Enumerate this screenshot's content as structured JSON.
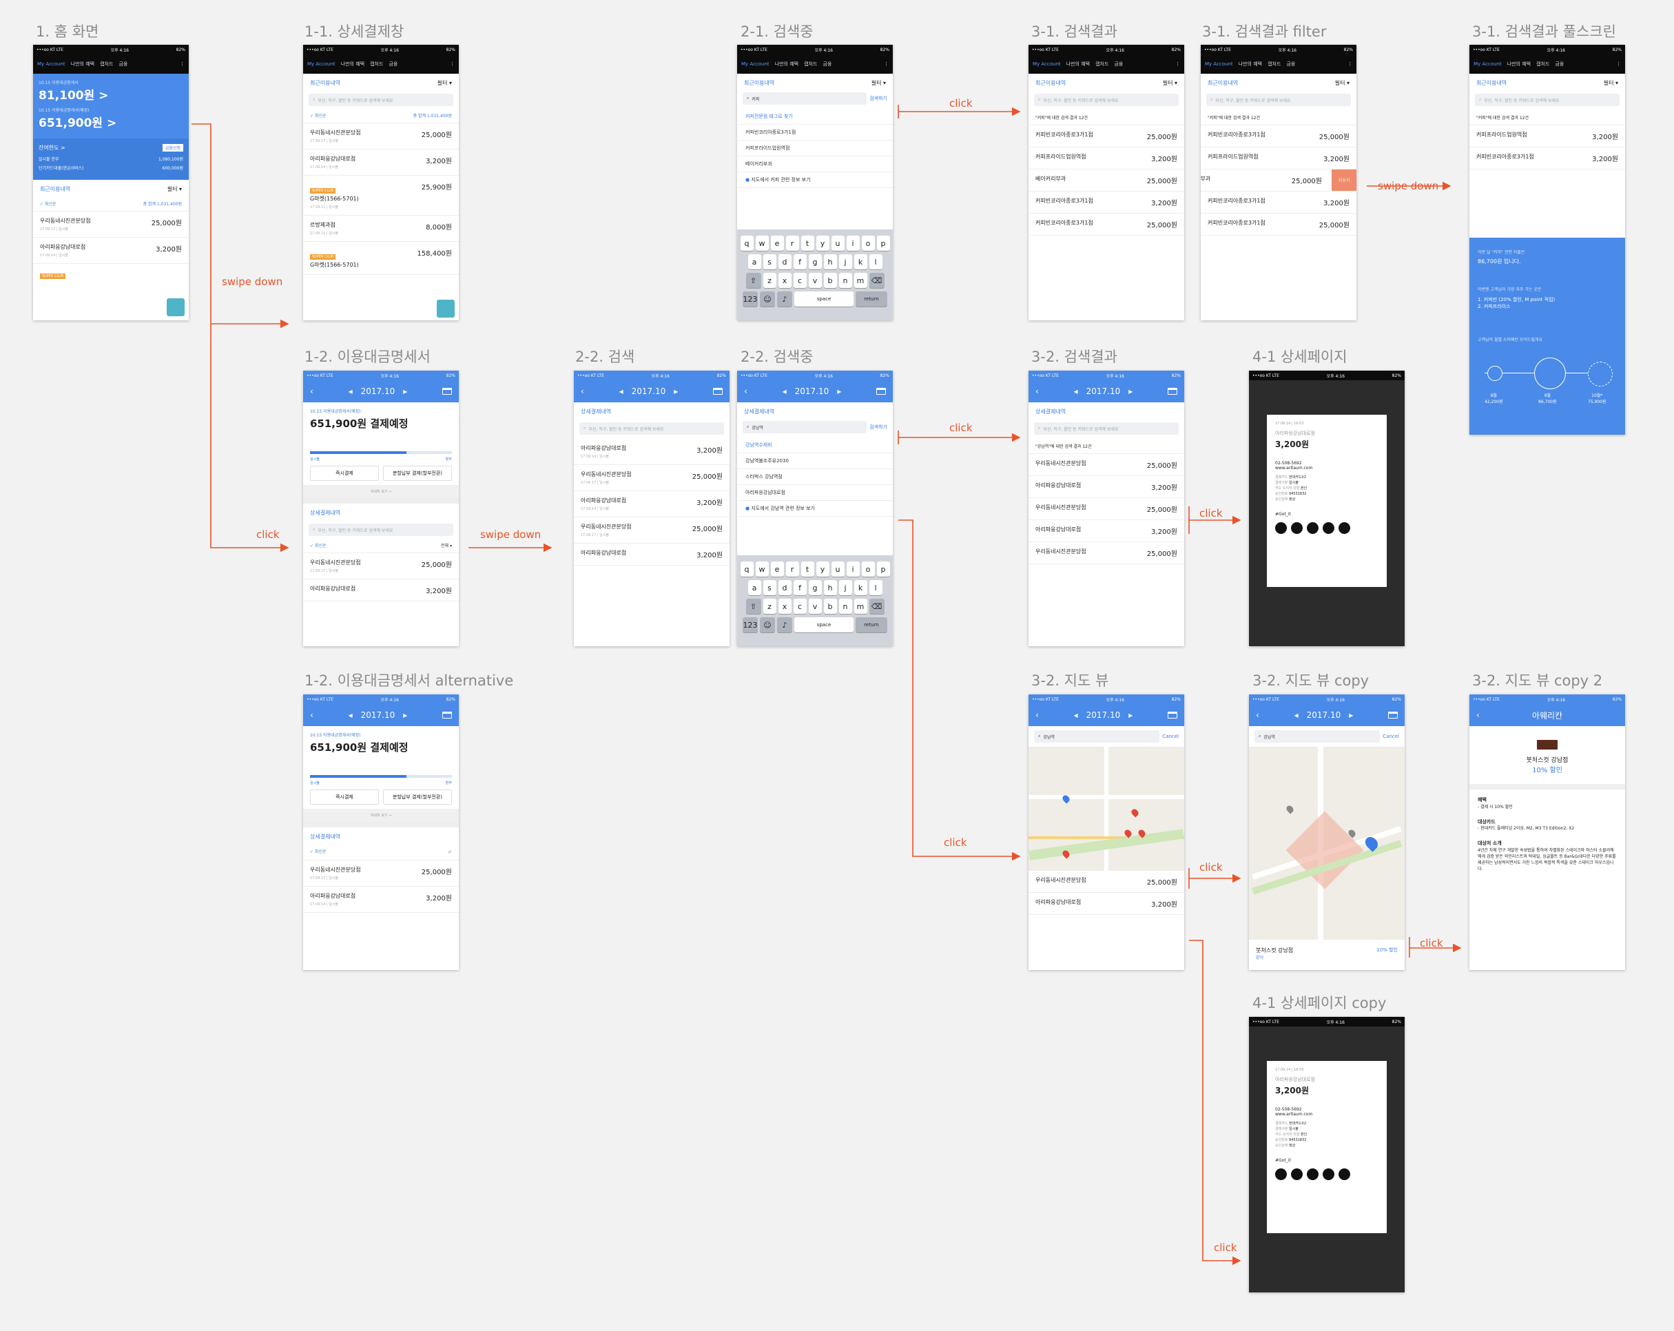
{
  "frames": {
    "f1": "1. 홈 화면",
    "f11": "1-1. 상세결제창",
    "f12": "1-2. 이용대금명세서",
    "f12alt": "1-2. 이용대금명세서 alternative",
    "f21": "2-1. 검색중",
    "f22a": "2-2. 검색",
    "f22b": "2-2. 검색중",
    "f31": "3-1. 검색결과",
    "f31filter": "3-1. 검색결과 filter",
    "f31full": "3-1. 검색결과 풀스크린",
    "f32": "3-2. 검색결과",
    "f32map": "3-2. 지도 뷰",
    "f32mapcopy": "3-2. 지도 뷰 copy",
    "f32mapcopy2": "3-2. 지도 뷰 copy 2",
    "f41": "4-1 상세페이지",
    "f41copy": "4-1 상세페이지 copy"
  },
  "arrows": {
    "swipe_down": "swipe down",
    "click": "click"
  },
  "common": {
    "carrier": "•••oo KT  LTE",
    "time": "오후 4:16",
    "battery": "82%",
    "nav": [
      "My Account",
      "나만의 혜택",
      "캡처드",
      "금융"
    ],
    "month": "2017.10",
    "recent": "최근이용내역",
    "filter": "필터 ▾",
    "detail_list": "상세결제내역",
    "search_placeholder": "부산, 직구, 할인 등 키워드로 검색해 보세요",
    "latest": "✓ 최신순",
    "total": "총 합계 1,031,400원",
    "all": "전체 ▾",
    "search_btn": "검색하기",
    "cancel": "Cancel",
    "super_club": "SUPER CLUB",
    "more": "자세히 보기 →"
  },
  "home": {
    "due_label": "10.15 이용대금명세서",
    "due_amount": "81,100원 >",
    "next_label": "10.15 이용대금명세서(예정)",
    "next_amount": "651,900원 >",
    "limit_label": "잔여한도 >",
    "limit_btn": "금융신청",
    "limit1_label": "일시불 한부",
    "limit1": "1,080,100원",
    "limit2_label": "단기카드대출(현금서비스)",
    "limit2": "600,000원"
  },
  "transactions": [
    {
      "name": "우리동네시진관분당점",
      "amount": "25,000원",
      "sub": "17.09.17 | 일시불"
    },
    {
      "name": "아리파응강남대로점",
      "amount": "3,200원",
      "sub": "17.09.14 | 일시불"
    },
    {
      "name": "G마켓(1566-5701)",
      "amount": "25,900원",
      "sub": "17.09.11 | 일시불"
    },
    {
      "name": "르방제과점",
      "amount": "8,000원",
      "sub": "17.09.11 | 일시불"
    },
    {
      "name": "G마켓(1566-5701)",
      "amount": "158,400원",
      "sub": "17.09.10 | 일시불"
    }
  ],
  "statement": {
    "label": "10.15 이용대금명세서(예정)",
    "amount": "651,900원 결제예정",
    "pay_now": "즉시결제",
    "installment": "분할납부 결제(할부전환)",
    "bar_left": "일시불",
    "bar_right": "할부"
  },
  "suggest_21": [
    "커피전문점 테그로 찾기",
    "커피빈코리아종로3가1점",
    "커피프라이드업원역점",
    "베이커리부과",
    "지도에서 커피 관련 정보 보기"
  ],
  "suggest_22": [
    "강남역수제비",
    "강남역불조주유2030",
    "스타벅스 강남역점",
    "아리파응강남대로점",
    "지도에서 강남역 관련 정보 보기"
  ],
  "query_21": "커피",
  "query_22": "강남역",
  "kb_rows": [
    [
      "q",
      "w",
      "e",
      "r",
      "t",
      "y",
      "u",
      "i",
      "o",
      "p"
    ],
    [
      "a",
      "s",
      "d",
      "f",
      "g",
      "h",
      "j",
      "k",
      "l"
    ],
    [
      "z",
      "x",
      "c",
      "v",
      "b",
      "n",
      "m"
    ]
  ],
  "kb_bottom": {
    "num": "123",
    "space": "space",
    "ret": "return"
  },
  "results_31": {
    "header": "\"커피\"에 대한 검색 결과 12건",
    "items": [
      {
        "name": "커피빈코리아종로3가1점",
        "amount": "25,000원"
      },
      {
        "name": "커피프라이드업원역점",
        "amount": "3,200원"
      },
      {
        "name": "베이커리부과",
        "amount": "25,000원"
      },
      {
        "name": "커피빈코리아종로3가1점",
        "amount": "3,200원"
      },
      {
        "name": "커피빈코리아종로3가1점",
        "amount": "25,000원"
      }
    ],
    "delete": "지우기"
  },
  "results_32": {
    "header": "\"강남역\"에 대한 검색 결과 12건",
    "items": [
      {
        "name": "우리동네시진관분당점",
        "amount": "25,000원"
      },
      {
        "name": "아리파응강남대로점",
        "amount": "3,200원"
      },
      {
        "name": "우리동네시진관분당점",
        "amount": "25,000원"
      },
      {
        "name": "아리파응강남대로점",
        "amount": "3,200원"
      },
      {
        "name": "우리동네시진관분당점",
        "amount": "25,000원"
      }
    ]
  },
  "fullscreen": {
    "top_items": [
      {
        "name": "커피프라이드업원역점",
        "amount": "3,200원"
      },
      {
        "name": "커피빈코리아종로3가1점",
        "amount": "3,200원"
      }
    ],
    "sum_label": "이번 달 \"커피\" 관련 지출은",
    "sum_value": "86,700원 입니다.",
    "best_label": "이번엔 고객님이 가장 자주 가는 곳은",
    "best1": "1. 커피빈 (20% 할인, M point 적립)",
    "best2": "2. 커피프라이스",
    "trend_label": "고객님의 월별 소비패턴 모어드릴게요",
    "months": [
      {
        "m": "8월",
        "v": "42,200원"
      },
      {
        "m": "9월",
        "v": "86,700원"
      },
      {
        "m": "10월*",
        "v": "75,900원"
      }
    ]
  },
  "receipt": {
    "date": "17.09.14 | 16:03",
    "merchant": "아리파응강남대로점",
    "amount": "3,200원",
    "phone": "02-508-5692",
    "url": "www.aritaum.com",
    "fields": [
      [
        "결제카드",
        "현대카드X2"
      ],
      [
        "결제구분",
        "일시불"
      ],
      [
        "카드 소지자 유형",
        "본인"
      ],
      [
        "승인번호",
        "94531832"
      ],
      [
        "승인상태",
        "정상"
      ]
    ],
    "hashtag": "#Got_it"
  },
  "map": {
    "store": "붓처스컷 강남점",
    "discount": "10% 할인",
    "store_sub": "양식"
  },
  "store_page": {
    "title": "아웨리칸",
    "store": "붓처스컷 강남점",
    "discount": "10% 할인",
    "benefit_h": "혜택",
    "benefit": "- 결제 시 10% 할인",
    "card_h": "대상카드",
    "card": "- 현대카드 플래티넘 2이상, M2, M3 T3 Edition2, X2",
    "intro_h": "대상처 소개",
    "intro": "4년간 자체 연구 개발한 숙성법을 통하여 차별화된 스테이크와 마스터 소믈리에에게 검증 받은 와인리스트와 탁대일, 싱글몰트 등 Bar&Grill다운 다양한 주류를 제공하는 남성적이면서도 거친 느낌의 복합적 특색을 갖춘 스테이크 하우스입니다."
  }
}
